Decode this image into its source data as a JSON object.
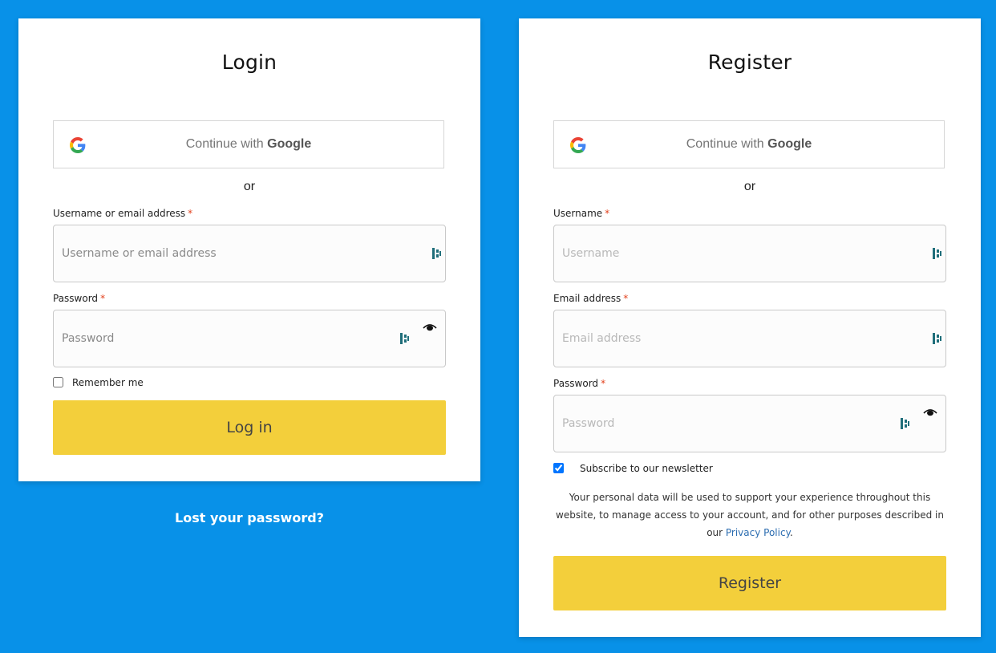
{
  "login": {
    "title": "Login",
    "google_button": {
      "prefix": "Continue with",
      "brand": "Google"
    },
    "or_text": "or",
    "username": {
      "label": "Username or email address",
      "required_mark": "*",
      "placeholder": "Username or email address",
      "value": ""
    },
    "password": {
      "label": "Password",
      "required_mark": "*",
      "placeholder": "Password",
      "value": ""
    },
    "remember_me": {
      "label": "Remember me",
      "checked": false
    },
    "submit_label": "Log in",
    "lost_password_link": "Lost your password?"
  },
  "register": {
    "title": "Register",
    "google_button": {
      "prefix": "Continue with",
      "brand": "Google"
    },
    "or_text": "or",
    "username": {
      "label": "Username",
      "required_mark": "*",
      "placeholder": "Username",
      "value": ""
    },
    "email": {
      "label": "Email address",
      "required_mark": "*",
      "placeholder": "Email address",
      "value": ""
    },
    "password": {
      "label": "Password",
      "required_mark": "*",
      "placeholder": "Password",
      "value": ""
    },
    "newsletter": {
      "label": "Subscribe to our newsletter",
      "checked": true
    },
    "privacy_text_before": "Your personal data will be used to support your experience throughout this website, to manage access to your account, and for other purposes described in our ",
    "privacy_link": "Privacy Policy",
    "privacy_text_after": ".",
    "submit_label": "Register"
  },
  "colors": {
    "background": "#0891e8",
    "button": "#f3cf3b",
    "required": "#e2401c",
    "link": "#2b6cb0"
  },
  "icons": [
    "google-logo-icon",
    "keeper-password-manager-icon",
    "eye-icon"
  ]
}
